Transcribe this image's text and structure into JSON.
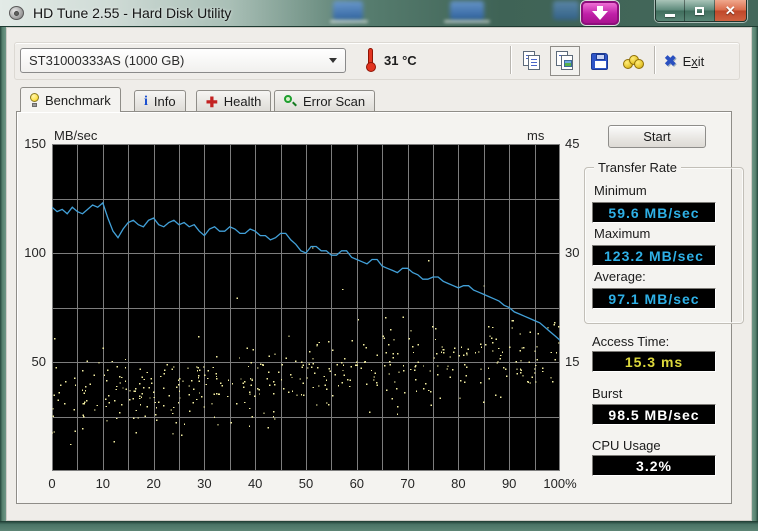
{
  "window": {
    "title": "HD Tune 2.55 - Hard Disk Utility"
  },
  "toolbar": {
    "drive_selector_value": "ST31000333AS (1000 GB)",
    "temperature": "31 °C",
    "exit": {
      "pre": "E",
      "accel": "x",
      "post": "it"
    },
    "icons": [
      "copy-text-icon",
      "copy-image-icon",
      "save-icon",
      "donate-coins-icon",
      "exit-icon"
    ]
  },
  "tabs": [
    {
      "id": "benchmark",
      "label": "Benchmark",
      "active": true
    },
    {
      "id": "info",
      "label": "Info",
      "active": false
    },
    {
      "id": "health",
      "label": "Health",
      "active": false
    },
    {
      "id": "error-scan",
      "label": "Error Scan",
      "active": false
    }
  ],
  "benchmark": {
    "start_button": "Start",
    "transfer_rate": {
      "group_label": "Transfer Rate",
      "minimum_label": "Minimum",
      "minimum_value": "59.6 MB/sec",
      "maximum_label": "Maximum",
      "maximum_value": "123.2 MB/sec",
      "average_label": "Average:",
      "average_value": "97.1 MB/sec"
    },
    "access_time_label": "Access Time:",
    "access_time_value": "15.3 ms",
    "burst_label": "Burst",
    "burst_value": "98.5 MB/sec",
    "cpu_label": "CPU Usage",
    "cpu_value": "3.2%"
  },
  "colors": {
    "line_blue": "#42a0d8",
    "dot_yellow": "#f2eda0",
    "grid": "#7d7d7d",
    "value_cyan": "#2eb0e6",
    "value_yellow": "#ddd83c",
    "value_white": "#ffffff"
  },
  "chart_data": {
    "type": "line",
    "title": "HD Tune benchmark: transfer rate line with access-time scatter",
    "left_axis": {
      "label": "MB/sec",
      "min": 0,
      "max": 150,
      "ticks": [
        150,
        100,
        50
      ]
    },
    "right_axis": {
      "label": "ms",
      "min": 0,
      "max": 45,
      "ticks": [
        45,
        30,
        15
      ]
    },
    "x_axis": {
      "min": 0,
      "max": 100,
      "tick_labels": [
        "0",
        "10",
        "20",
        "30",
        "40",
        "50",
        "60",
        "70",
        "80",
        "90",
        "100%"
      ]
    },
    "grid": {
      "x_step_pct": 5,
      "y_step_left_units": 25
    },
    "series": [
      {
        "name": "transfer-rate",
        "type": "line",
        "unit": "MB/sec",
        "summary": {
          "minimum": 59.6,
          "maximum": 123.2,
          "average": 97.1
        },
        "points": [
          [
            0,
            121
          ],
          [
            1,
            119
          ],
          [
            2,
            120
          ],
          [
            3,
            118
          ],
          [
            4,
            121
          ],
          [
            5,
            119
          ],
          [
            6,
            118
          ],
          [
            7,
            120
          ],
          [
            8,
            122
          ],
          [
            9,
            121
          ],
          [
            10,
            123
          ],
          [
            11,
            116
          ],
          [
            12,
            110
          ],
          [
            13,
            107
          ],
          [
            14,
            111
          ],
          [
            15,
            114
          ],
          [
            16,
            115
          ],
          [
            17,
            113
          ],
          [
            18,
            112
          ],
          [
            19,
            115
          ],
          [
            20,
            116
          ],
          [
            21,
            113
          ],
          [
            22,
            112
          ],
          [
            23,
            114
          ],
          [
            24,
            115
          ],
          [
            25,
            113
          ],
          [
            26,
            114
          ],
          [
            27,
            112
          ],
          [
            28,
            113
          ],
          [
            29,
            110
          ],
          [
            30,
            108
          ],
          [
            31,
            111
          ],
          [
            32,
            112
          ],
          [
            33,
            110
          ],
          [
            34,
            110
          ],
          [
            35,
            112
          ],
          [
            36,
            111
          ],
          [
            37,
            109
          ],
          [
            38,
            109
          ],
          [
            39,
            111
          ],
          [
            40,
            110
          ],
          [
            41,
            108
          ],
          [
            42,
            108
          ],
          [
            43,
            106
          ],
          [
            44,
            107
          ],
          [
            45,
            109
          ],
          [
            46,
            109
          ],
          [
            47,
            106
          ],
          [
            48,
            104
          ],
          [
            49,
            101
          ],
          [
            50,
            100
          ],
          [
            51,
            103
          ],
          [
            52,
            103
          ],
          [
            53,
            101
          ],
          [
            54,
            101
          ],
          [
            55,
            99
          ],
          [
            56,
            99
          ],
          [
            57,
            101
          ],
          [
            58,
            101
          ],
          [
            59,
            98
          ],
          [
            60,
            97
          ],
          [
            61,
            96
          ],
          [
            62,
            95
          ],
          [
            63,
            97
          ],
          [
            64,
            97
          ],
          [
            65,
            94
          ],
          [
            66,
            93
          ],
          [
            67,
            92
          ],
          [
            68,
            91
          ],
          [
            69,
            93
          ],
          [
            70,
            93
          ],
          [
            71,
            91
          ],
          [
            72,
            90
          ],
          [
            73,
            88
          ],
          [
            74,
            88
          ],
          [
            75,
            89
          ],
          [
            76,
            89
          ],
          [
            77,
            87
          ],
          [
            78,
            86
          ],
          [
            79,
            85
          ],
          [
            80,
            84
          ],
          [
            81,
            85
          ],
          [
            82,
            85
          ],
          [
            83,
            83
          ],
          [
            84,
            82
          ],
          [
            85,
            81
          ],
          [
            86,
            80
          ],
          [
            87,
            79
          ],
          [
            88,
            78
          ],
          [
            89,
            76
          ],
          [
            90,
            75
          ],
          [
            91,
            73
          ],
          [
            92,
            72
          ],
          [
            93,
            71
          ],
          [
            94,
            70
          ],
          [
            95,
            69
          ],
          [
            96,
            68
          ],
          [
            97,
            66
          ],
          [
            98,
            64
          ],
          [
            99,
            62
          ],
          [
            100,
            60
          ]
        ]
      },
      {
        "name": "access-time",
        "type": "scatter",
        "unit": "ms",
        "summary": {
          "average": 15.3
        },
        "generator": {
          "seed": 11,
          "count": 430,
          "center_start_ms": 9.5,
          "center_slope_per_pct": 0.07,
          "spread_ms": 5.2,
          "min_ms": 2.2,
          "max_ms": 40,
          "outlier_rate": 0.02,
          "outlier_extra_ms": 16
        }
      }
    ]
  }
}
